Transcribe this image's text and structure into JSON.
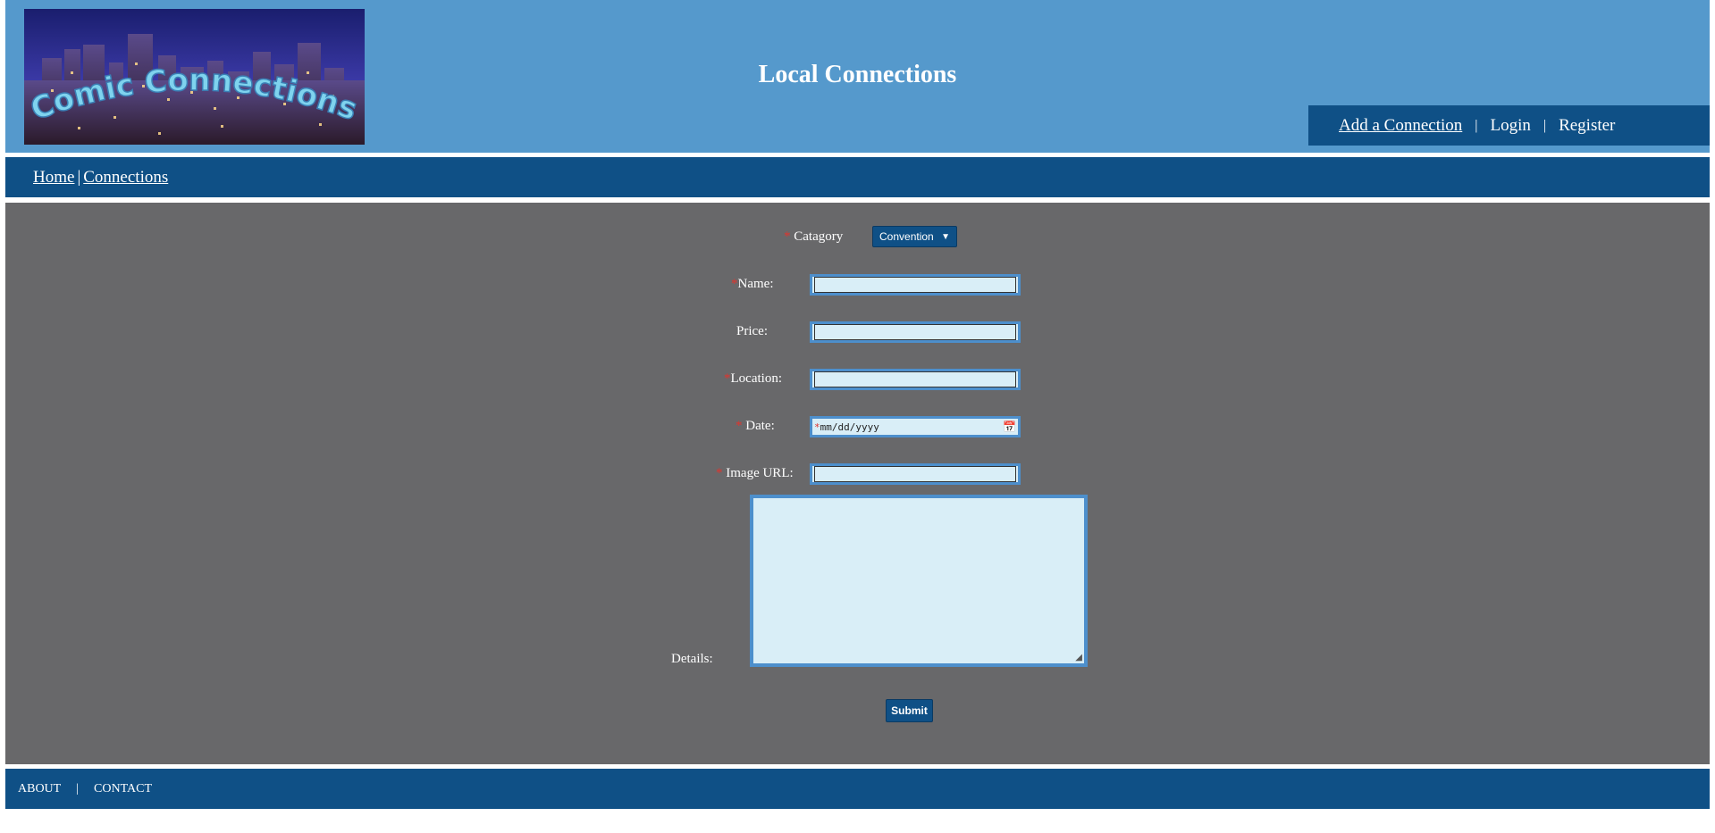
{
  "header": {
    "logo_text": "Comic Connections",
    "title": "Local Connections",
    "user_nav": {
      "add_connection": "Add a Connection",
      "separator": "|",
      "login": "Login",
      "register": "Register"
    }
  },
  "breadcrumb": {
    "home": "Home",
    "separator": "|",
    "connections": "Connections"
  },
  "form": {
    "required_marker": "*",
    "category": {
      "label": "Catagory",
      "selected": "Convention"
    },
    "name": {
      "label": "Name:",
      "value": ""
    },
    "price": {
      "label": "Price:",
      "value": ""
    },
    "location": {
      "label": "Location:",
      "value": ""
    },
    "date": {
      "label": "Date:",
      "placeholder": "mm/dd/yyyy"
    },
    "image_url": {
      "label": "Image URL:",
      "value": ""
    },
    "details": {
      "label": "Details:",
      "value": ""
    },
    "submit_label": "Submit"
  },
  "footer": {
    "about": "ABOUT",
    "separator": "|",
    "contact": "CONTACT"
  },
  "colors": {
    "header_bg": "#5599cc",
    "nav_bg": "#0f5086",
    "main_bg": "#68686a",
    "input_bg": "#d9eef7",
    "input_border": "#4d8fcc",
    "required": "#e0342e"
  },
  "icons": {
    "date_picker": "calendar-icon",
    "select_arrow": "chevron-down-icon",
    "resize": "resize-handle-icon"
  }
}
